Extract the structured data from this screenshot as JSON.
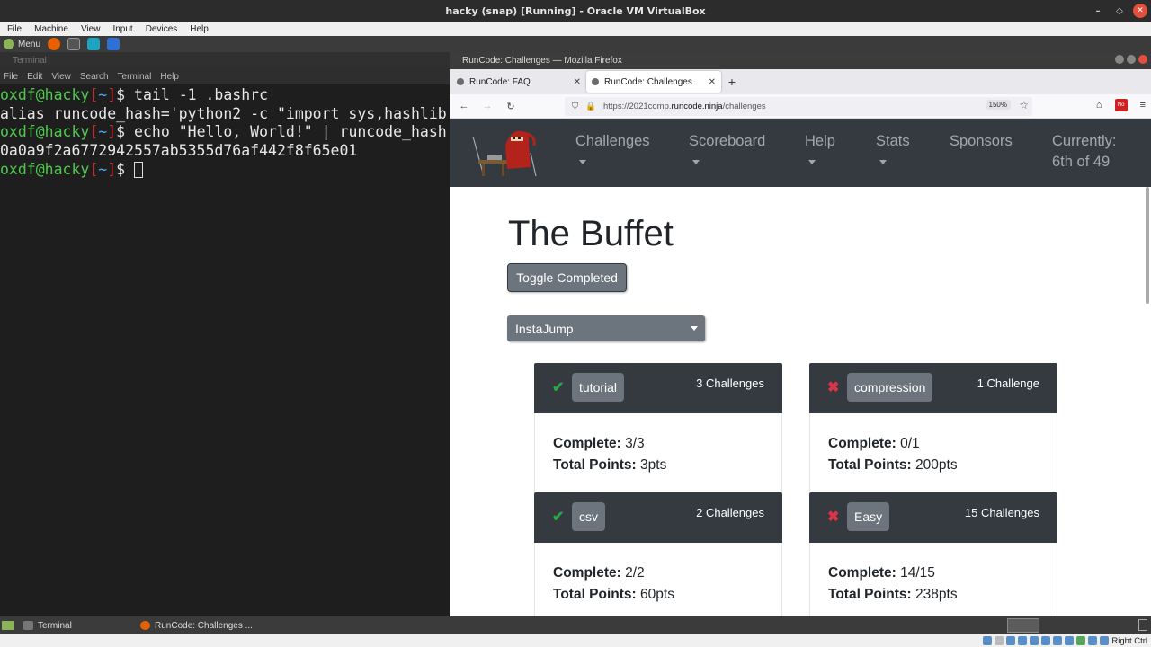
{
  "host": {
    "window_title": "hacky (snap) [Running] - Oracle VM VirtualBox",
    "menu": [
      "File",
      "Machine",
      "View",
      "Input",
      "Devices",
      "Help"
    ],
    "status_right": "Right Ctrl"
  },
  "guest_panel": {
    "menu_label": "Menu"
  },
  "terminal": {
    "title": "Terminal",
    "menu": [
      "File",
      "Edit",
      "View",
      "Search",
      "Terminal",
      "Help"
    ],
    "lines": [
      {
        "user": "oxdf@hacky",
        "path": "~",
        "cmd": " tail -1 .bashrc"
      },
      {
        "output": "alias runcode_hash='python2 -c \"import sys,hashlib"
      },
      {
        "user": "oxdf@hacky",
        "path": "~",
        "cmd": " echo \"Hello, World!\" | runcode_hash"
      },
      {
        "output": "0a0a9f2a6772942557ab5355d76af442f8f65e01"
      },
      {
        "user": "oxdf@hacky",
        "path": "~",
        "cmd": " "
      }
    ]
  },
  "firefox": {
    "window_title": "RunCode: Challenges — Mozilla Firefox",
    "tabs": [
      {
        "label": "RunCode: FAQ",
        "active": false
      },
      {
        "label": "RunCode: Challenges",
        "active": true
      }
    ],
    "url_prefix": "https://2021comp.",
    "url_host": "runcode.ninja",
    "url_path": "/challenges",
    "zoom": "150%",
    "ext_badge": "No"
  },
  "site": {
    "nav": {
      "challenges": "Challenges",
      "scoreboard": "Scoreboard",
      "help": "Help",
      "stats": "Stats",
      "sponsors": "Sponsors",
      "currently_line1": "Currently:",
      "currently_line2": "6th of 49"
    },
    "title": "The Buffet",
    "toggle_button": "Toggle Completed",
    "instajump": "InstaJump",
    "complete_label": "Complete:",
    "points_label": "Total Points:",
    "cards": [
      {
        "tag": "tutorial",
        "status": "complete",
        "count": "3 Challenges",
        "complete": "3/3",
        "points": "3pts"
      },
      {
        "tag": "compression",
        "status": "incomplete",
        "count": "1 Challenge",
        "complete": "0/1",
        "points": "200pts"
      },
      {
        "tag": "csv",
        "status": "complete",
        "count": "2 Challenges",
        "complete": "2/2",
        "points": "60pts"
      },
      {
        "tag": "Easy",
        "status": "incomplete",
        "count": "15 Challenges",
        "complete": "14/15",
        "points": "238pts"
      }
    ]
  },
  "taskbar": {
    "items": [
      {
        "label": "Terminal",
        "icon": "terminal-icon"
      },
      {
        "label": "RunCode: Challenges ...",
        "icon": "firefox-icon"
      }
    ]
  },
  "icons": {
    "status_complete": "✔",
    "status_incomplete": "✖"
  },
  "colors": {
    "navbar": "#343a40",
    "button_gray": "#6c757d",
    "success": "#28a745",
    "danger": "#dc3545",
    "prompt_user": "#4ec94e",
    "prompt_path": "#4ea5ff"
  }
}
